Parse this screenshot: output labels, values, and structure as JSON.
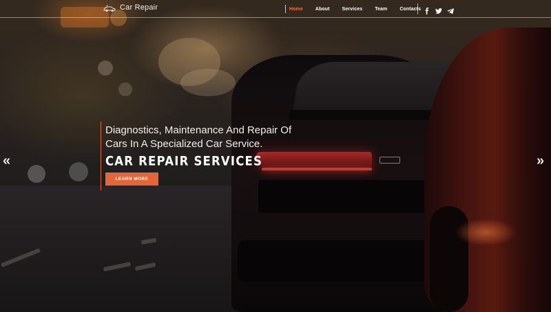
{
  "brand": {
    "name": "Car Repair",
    "icon": "car-logo-icon"
  },
  "nav": {
    "items": [
      {
        "label": "Home",
        "active": true
      },
      {
        "label": "About",
        "active": false
      },
      {
        "label": "Services",
        "active": false
      },
      {
        "label": "Team",
        "active": false
      },
      {
        "label": "Contacts",
        "active": false
      }
    ]
  },
  "social": [
    "facebook-icon",
    "twitter-icon",
    "telegram-icon"
  ],
  "hero": {
    "subtitle": "Diagnostics, Maintenance And Repair Of Cars In A Specialized Car Service.",
    "title": "CAR REPAIR SERVICES",
    "button_label": "LEARN MORE"
  },
  "slider": {
    "prev_icon": "«",
    "next_icon": "»"
  },
  "colors": {
    "accent": "#e3673a",
    "active_nav": "#f0703e",
    "text": "#ffffff"
  }
}
